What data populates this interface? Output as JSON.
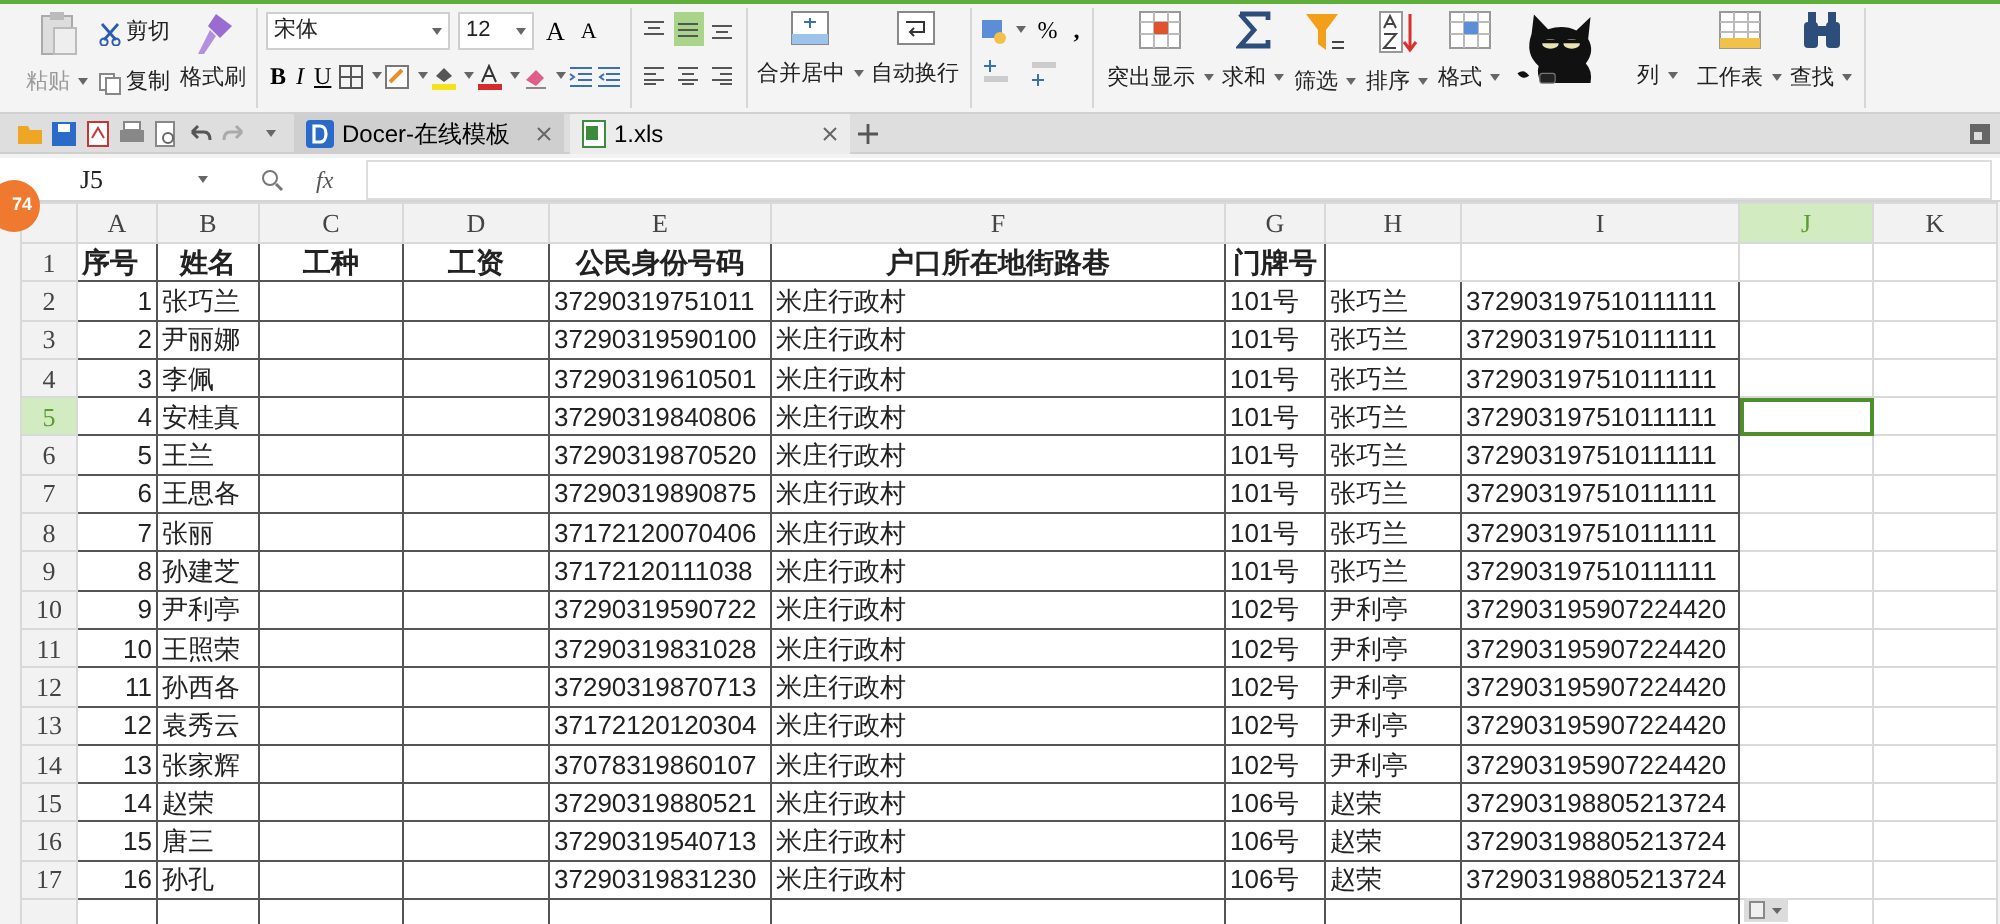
{
  "ribbon": {
    "clipboard": [
      {
        "kind": "paste",
        "label": "粘贴",
        "disabled": true
      },
      {
        "kind": "cut",
        "label": "剪切",
        "disabled": false
      },
      {
        "kind": "copy",
        "label": "复制",
        "disabled": false
      },
      {
        "kind": "painter",
        "label": "格式刷",
        "disabled": false
      }
    ],
    "font": {
      "name": "宋体",
      "size": "12"
    },
    "font_buttons": [
      {
        "kind": "grow",
        "label": "A"
      },
      {
        "kind": "shrink",
        "label": "A"
      },
      {
        "kind": "bold",
        "label": "B"
      },
      {
        "kind": "italic",
        "label": "I"
      },
      {
        "kind": "underline",
        "label": "U"
      }
    ],
    "alignments": [
      {
        "kind": "top",
        "selected": false
      },
      {
        "kind": "middle",
        "selected": true
      },
      {
        "kind": "bottom",
        "selected": false
      },
      {
        "kind": "left",
        "selected": false
      },
      {
        "kind": "center",
        "selected": false
      },
      {
        "kind": "right",
        "selected": false
      }
    ],
    "merge": [
      {
        "kind": "merge",
        "label": "合并居中"
      },
      {
        "kind": "wrap",
        "label": "自动换行"
      }
    ],
    "number": {
      "percent": "%",
      "comma": ","
    },
    "tools": [
      {
        "kind": "highlight",
        "label": "突出显示"
      },
      {
        "kind": "sum",
        "label": "求和"
      },
      {
        "kind": "filter",
        "label": "筛选"
      },
      {
        "kind": "sort",
        "label": "排序"
      },
      {
        "kind": "format",
        "label": "格式"
      },
      {
        "kind": "rowcol",
        "label": "列"
      },
      {
        "kind": "sheet",
        "label": "工作表"
      },
      {
        "kind": "find",
        "label": "查找"
      }
    ]
  },
  "tabs": [
    {
      "kind": "docer",
      "label": "Docer-在线模板",
      "selected": false
    },
    {
      "kind": "xls",
      "label": "1.xls",
      "selected": true
    }
  ],
  "formula_bar": {
    "name_box": "J5",
    "fx": "fx"
  },
  "badge": "74",
  "columns": [
    {
      "letter": "A",
      "selected": false
    },
    {
      "letter": "B",
      "selected": false
    },
    {
      "letter": "C",
      "selected": false
    },
    {
      "letter": "D",
      "selected": false
    },
    {
      "letter": "E",
      "selected": false
    },
    {
      "letter": "F",
      "selected": false
    },
    {
      "letter": "G",
      "selected": false
    },
    {
      "letter": "H",
      "selected": false
    },
    {
      "letter": "I",
      "selected": false
    },
    {
      "letter": "J",
      "selected": true
    },
    {
      "letter": "K",
      "selected": false
    }
  ],
  "rows": [
    {
      "num": "1",
      "selected": false,
      "seq": "序号",
      "name": "姓名",
      "job": "工种",
      "wage": "工资",
      "id": "公民身份号码",
      "address": "户口所在地街路巷",
      "door": "门牌号"
    },
    {
      "num": "2",
      "selected": false,
      "seq": "1",
      "name": "张巧兰",
      "id": "37290319751011",
      "address": "米庄行政村",
      "door": "101号",
      "col_h": "张巧兰",
      "col_i": "372903197510111111"
    },
    {
      "num": "3",
      "selected": false,
      "seq": "2",
      "name": "尹丽娜",
      "id": "37290319590100",
      "address": "米庄行政村",
      "door": "101号",
      "col_h": "张巧兰",
      "col_i": "372903197510111111"
    },
    {
      "num": "4",
      "selected": false,
      "seq": "3",
      "name": "李佩",
      "id": "37290319610501",
      "address": "米庄行政村",
      "door": "101号",
      "col_h": "张巧兰",
      "col_i": "372903197510111111"
    },
    {
      "num": "5",
      "selected": true,
      "seq": "4",
      "name": "安桂真",
      "id": "37290319840806",
      "address": "米庄行政村",
      "door": "101号",
      "col_h": "张巧兰",
      "col_i": "372903197510111111"
    },
    {
      "num": "6",
      "selected": false,
      "seq": "5",
      "name": "王兰",
      "id": "37290319870520",
      "address": "米庄行政村",
      "door": "101号",
      "col_h": "张巧兰",
      "col_i": "372903197510111111"
    },
    {
      "num": "7",
      "selected": false,
      "seq": "6",
      "name": "王思各",
      "id": "37290319890875",
      "address": "米庄行政村",
      "door": "101号",
      "col_h": "张巧兰",
      "col_i": "372903197510111111"
    },
    {
      "num": "8",
      "selected": false,
      "seq": "7",
      "name": "张丽",
      "id": "37172120070406",
      "address": "米庄行政村",
      "door": "101号",
      "col_h": "张巧兰",
      "col_i": "372903197510111111"
    },
    {
      "num": "9",
      "selected": false,
      "seq": "8",
      "name": "孙建芝",
      "id": "37172120111038",
      "address": "米庄行政村",
      "door": "101号",
      "col_h": "张巧兰",
      "col_i": "372903197510111111"
    },
    {
      "num": "10",
      "selected": false,
      "seq": "9",
      "name": "尹利亭",
      "id": "37290319590722",
      "address": "米庄行政村",
      "door": "102号",
      "col_h": "尹利亭",
      "col_i": "372903195907224420"
    },
    {
      "num": "11",
      "selected": false,
      "seq": "10",
      "name": "王照荣",
      "id": "37290319831028",
      "address": "米庄行政村",
      "door": "102号",
      "col_h": "尹利亭",
      "col_i": "372903195907224420"
    },
    {
      "num": "12",
      "selected": false,
      "seq": "11",
      "name": "孙西各",
      "id": "37290319870713",
      "address": "米庄行政村",
      "door": "102号",
      "col_h": "尹利亭",
      "col_i": "372903195907224420"
    },
    {
      "num": "13",
      "selected": false,
      "seq": "12",
      "name": "袁秀云",
      "id": "37172120120304",
      "address": "米庄行政村",
      "door": "102号",
      "col_h": "尹利亭",
      "col_i": "372903195907224420"
    },
    {
      "num": "14",
      "selected": false,
      "seq": "13",
      "name": "张家辉",
      "id": "37078319860107",
      "address": "米庄行政村",
      "door": "102号",
      "col_h": "尹利亭",
      "col_i": "372903195907224420"
    },
    {
      "num": "15",
      "selected": false,
      "seq": "14",
      "name": "赵荣",
      "id": "37290319880521",
      "address": "米庄行政村",
      "door": "106号",
      "col_h": "赵荣",
      "col_i": "372903198805213724"
    },
    {
      "num": "16",
      "selected": false,
      "seq": "15",
      "name": "唐三",
      "id": "37290319540713",
      "address": "米庄行政村",
      "door": "106号",
      "col_h": "赵荣",
      "col_i": "372903198805213724"
    },
    {
      "num": "17",
      "selected": false,
      "seq": "16",
      "name": "孙孔",
      "id": "37290319831230",
      "address": "米庄行政村",
      "door": "106号",
      "col_h": "赵荣",
      "col_i": "372903198805213724"
    }
  ]
}
